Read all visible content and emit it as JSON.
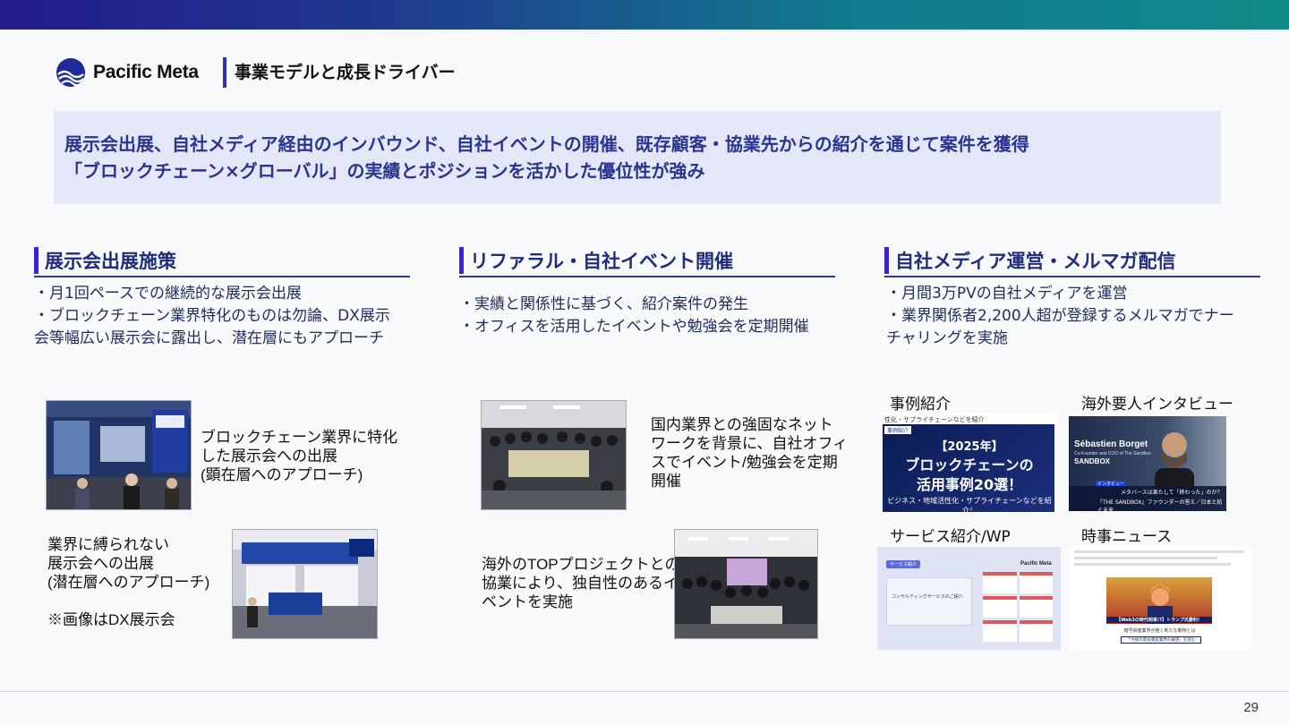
{
  "header": {
    "brand": "Pacific Meta",
    "title": "事業モデルと成長ドライバー"
  },
  "summary": {
    "line1": "展示会出展、自社メディア経由のインバウンド、自社イベントの開催、既存顧客・協業先からの紹介を通じて案件を獲得",
    "line2": "「ブロックチェーン×グローバル」の実績とポジションを活かした優位性が強み"
  },
  "columns": [
    {
      "heading": "展示会出展施策",
      "bullets": [
        "・月1回ペースでの継続的な展示会出展",
        "・ブロックチェーン業界特化のものは勿論、DX展示",
        "会等幅広い展示会に露出し、潜在層にもアプローチ"
      ],
      "photo1_caption": [
        "ブロックチェーン業界に特化",
        "した展示会への出展",
        "(顕在層へのアプローチ)"
      ],
      "photo2_caption": [
        "業界に縛られない",
        "展示会への出展",
        "(潜在層へのアプローチ)",
        "",
        "※画像はDX展示会"
      ]
    },
    {
      "heading": "リファラル・自社イベント開催",
      "bullets": [
        "・実績と関係性に基づく、紹介案件の発生",
        "・オフィスを活用したイベントや勉強会を定期開催"
      ],
      "photo1_caption": [
        "国内業界との強固なネット",
        "ワークを背景に、自社オフィ",
        "スでイベント/勉強会を定期",
        "開催"
      ],
      "photo2_caption": [
        "海外のTOPプロジェクトとの",
        "協業により、独自性のあるイ",
        "ベントを実施"
      ]
    },
    {
      "heading": "自社メディア運営・メルマガ配信",
      "bullets": [
        "・月間3万PVの自社メディアを運営",
        "・業界関係者2,200人超が登録するメルマガでナー",
        "チャリングを実施"
      ],
      "media": [
        {
          "label": "事例紹介",
          "thumb_top": "性化・サプライチェーンなどを紹介",
          "thumb_badge": "事例紹介",
          "thumb_line1": "【2025年】",
          "thumb_line2": "ブロックチェーンの",
          "thumb_line3": "活用事例20選！",
          "thumb_sub": "ビジネス・地域活性化・サプライチェーンなどを紹介！"
        },
        {
          "label": "海外要人インタビュー",
          "thumb_name": "Sébastien Borget",
          "thumb_role": "Co-Founder and COO of The Sandbox",
          "thumb_brand": "SANDBOX",
          "thumb_tag": "インタビュー",
          "thumb_q1": "メタバースは果たして「終わった」のか？",
          "thumb_q2": "『THE SANDBOX』ファウンダーの答え／日本と紡ぐ未来"
        },
        {
          "label": "サービス紹介/WP",
          "thumb_tag": "サービス紹介",
          "thumb_doc": "コンサルティングサービスのご紹介",
          "thumb_brand": "Pacific Meta"
        },
        {
          "label": "時事ニュース",
          "thumb_banner": "【Web3の時代到来!?】トランプ氏勝利！",
          "thumb_banner2": "暗号資産業界が抱く新たな期待とは",
          "thumb_btn": "「今後の暗号資産業界の展望」を読む"
        }
      ]
    }
  ],
  "page_number": "29"
}
